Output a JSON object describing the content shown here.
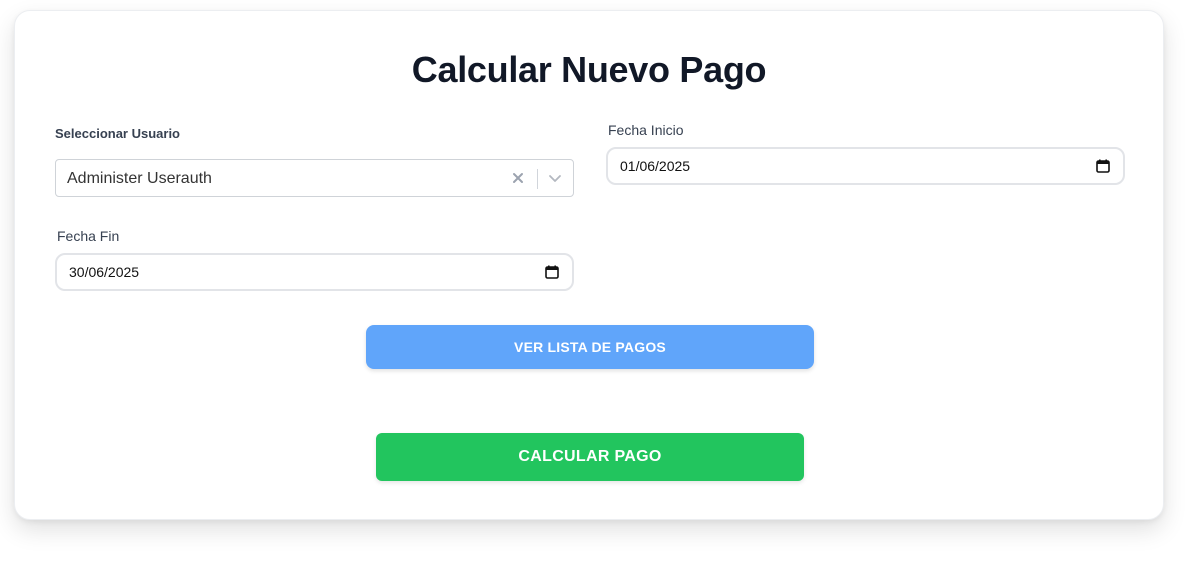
{
  "form": {
    "title": "Calcular Nuevo Pago",
    "user_select": {
      "label": "Seleccionar Usuario",
      "value": "Administer Userauth",
      "clear_icon": "close-icon",
      "dropdown_icon": "chevron-down-icon"
    },
    "start_date": {
      "label": "Fecha Inicio",
      "value": "01/06/2025",
      "icon": "calendar-icon"
    },
    "end_date": {
      "label": "Fecha Fin",
      "value": "30/06/2025",
      "icon": "calendar-icon"
    },
    "list_button": {
      "label": "VER LISTA DE PAGOS",
      "color": "#60a5fa"
    },
    "calculate_button": {
      "label": "CALCULAR PAGO",
      "color": "#22c55e"
    }
  }
}
